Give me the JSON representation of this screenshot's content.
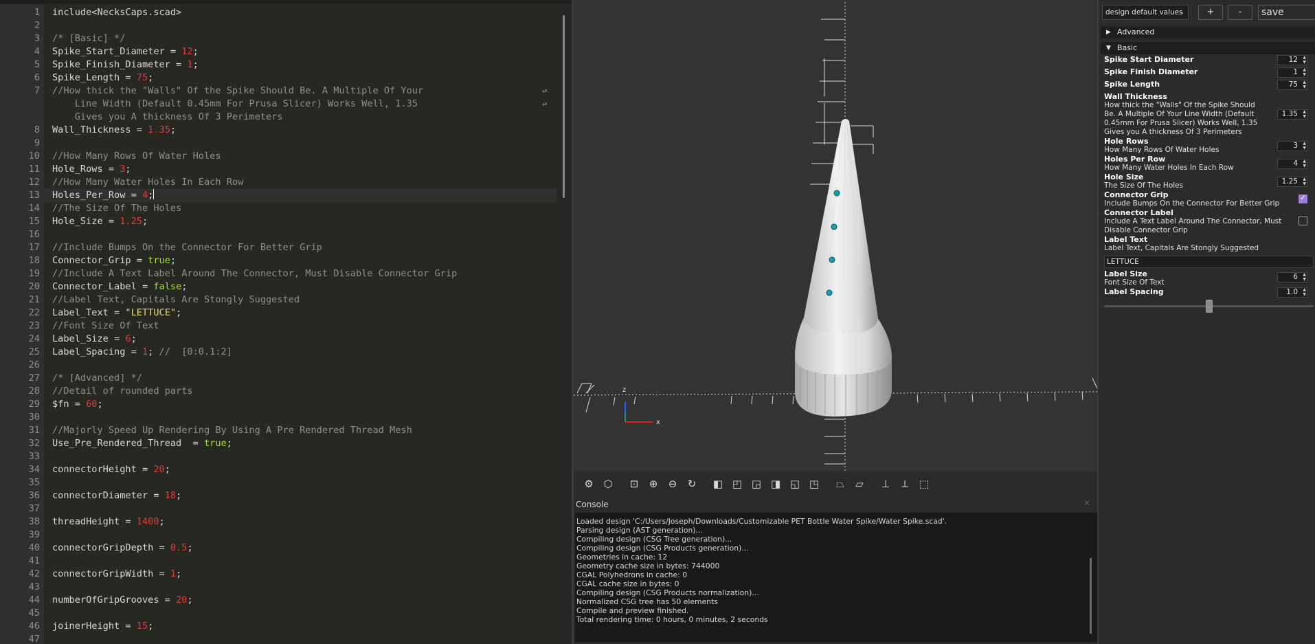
{
  "editor": {
    "lines": [
      {
        "n": "1",
        "parts": [
          {
            "t": "include<NecksCaps.scad>",
            "c": ""
          }
        ]
      },
      {
        "n": "2",
        "parts": []
      },
      {
        "n": "3",
        "parts": [
          {
            "t": "/* [Basic] */",
            "c": "c-comment"
          }
        ]
      },
      {
        "n": "4",
        "parts": [
          {
            "t": "Spike_Start_Diameter = ",
            "c": ""
          },
          {
            "t": "12",
            "c": "c-num"
          },
          {
            "t": ";",
            "c": ""
          }
        ]
      },
      {
        "n": "5",
        "parts": [
          {
            "t": "Spike_Finish_Diameter = ",
            "c": ""
          },
          {
            "t": "1",
            "c": "c-num"
          },
          {
            "t": ";",
            "c": ""
          }
        ]
      },
      {
        "n": "6",
        "parts": [
          {
            "t": "Spike_Length = ",
            "c": ""
          },
          {
            "t": "75",
            "c": "c-num"
          },
          {
            "t": ";",
            "c": ""
          }
        ]
      },
      {
        "n": "7",
        "wrap": true,
        "parts": [
          {
            "t": "//How thick the \"Walls\" Of the Spike Should Be. A Multiple Of Your\n    Line Width (Default 0.45mm For Prusa Slicer) Works Well, 1.35\n    Gives you A thickness Of 3 Perimeters",
            "c": "c-comment"
          }
        ]
      },
      {
        "n": "8",
        "parts": [
          {
            "t": "Wall_Thickness = ",
            "c": ""
          },
          {
            "t": "1.35",
            "c": "c-num"
          },
          {
            "t": ";",
            "c": ""
          }
        ]
      },
      {
        "n": "9",
        "parts": []
      },
      {
        "n": "10",
        "parts": [
          {
            "t": "//How Many Rows Of Water Holes",
            "c": "c-comment"
          }
        ]
      },
      {
        "n": "11",
        "parts": [
          {
            "t": "Hole_Rows = ",
            "c": ""
          },
          {
            "t": "3",
            "c": "c-num"
          },
          {
            "t": ";",
            "c": ""
          }
        ]
      },
      {
        "n": "12",
        "parts": [
          {
            "t": "//How Many Water Holes In Each Row",
            "c": "c-comment"
          }
        ]
      },
      {
        "n": "13",
        "current": true,
        "parts": [
          {
            "t": "Holes_Per_Row = ",
            "c": ""
          },
          {
            "t": "4",
            "c": "c-num"
          },
          {
            "t": ";",
            "c": ""
          }
        ]
      },
      {
        "n": "14",
        "parts": [
          {
            "t": "//The Size Of The Holes",
            "c": "c-comment"
          }
        ]
      },
      {
        "n": "15",
        "parts": [
          {
            "t": "Hole_Size = ",
            "c": ""
          },
          {
            "t": "1.25",
            "c": "c-num"
          },
          {
            "t": ";",
            "c": ""
          }
        ]
      },
      {
        "n": "16",
        "parts": []
      },
      {
        "n": "17",
        "parts": [
          {
            "t": "//Include Bumps On the Connector For Better Grip",
            "c": "c-comment"
          }
        ]
      },
      {
        "n": "18",
        "parts": [
          {
            "t": "Connector_Grip = ",
            "c": ""
          },
          {
            "t": "true",
            "c": "c-kw"
          },
          {
            "t": ";",
            "c": ""
          }
        ]
      },
      {
        "n": "19",
        "parts": [
          {
            "t": "//Include A Text Label Around The Connector, Must Disable Connector Grip",
            "c": "c-comment"
          }
        ]
      },
      {
        "n": "20",
        "parts": [
          {
            "t": "Connector_Label = ",
            "c": ""
          },
          {
            "t": "false",
            "c": "c-kw"
          },
          {
            "t": ";",
            "c": ""
          }
        ]
      },
      {
        "n": "21",
        "parts": [
          {
            "t": "//Label Text, Capitals Are Stongly Suggested",
            "c": "c-comment"
          }
        ]
      },
      {
        "n": "22",
        "parts": [
          {
            "t": "Label_Text = ",
            "c": ""
          },
          {
            "t": "\"LETTUCE\"",
            "c": "c-str"
          },
          {
            "t": ";",
            "c": ""
          }
        ]
      },
      {
        "n": "23",
        "parts": [
          {
            "t": "//Font Size Of Text",
            "c": "c-comment"
          }
        ]
      },
      {
        "n": "24",
        "parts": [
          {
            "t": "Label_Size = ",
            "c": ""
          },
          {
            "t": "6",
            "c": "c-num"
          },
          {
            "t": ";",
            "c": ""
          }
        ]
      },
      {
        "n": "25",
        "parts": [
          {
            "t": "Label_Spacing = ",
            "c": ""
          },
          {
            "t": "1",
            "c": "c-num"
          },
          {
            "t": "; ",
            "c": ""
          },
          {
            "t": "//  [0:0.1:2]",
            "c": "c-comment"
          }
        ]
      },
      {
        "n": "26",
        "parts": []
      },
      {
        "n": "27",
        "parts": [
          {
            "t": "/* [Advanced] */",
            "c": "c-comment"
          }
        ]
      },
      {
        "n": "28",
        "parts": [
          {
            "t": "//Detail of rounded parts",
            "c": "c-comment"
          }
        ]
      },
      {
        "n": "29",
        "parts": [
          {
            "t": "$fn = ",
            "c": ""
          },
          {
            "t": "60",
            "c": "c-num"
          },
          {
            "t": ";",
            "c": ""
          }
        ]
      },
      {
        "n": "30",
        "parts": []
      },
      {
        "n": "31",
        "parts": [
          {
            "t": "//Majorly Speed Up Rendering By Using A Pre Rendered Thread Mesh",
            "c": "c-comment"
          }
        ]
      },
      {
        "n": "32",
        "parts": [
          {
            "t": "Use_Pre_Rendered_Thread  = ",
            "c": ""
          },
          {
            "t": "true",
            "c": "c-kw"
          },
          {
            "t": ";",
            "c": ""
          }
        ]
      },
      {
        "n": "33",
        "parts": []
      },
      {
        "n": "34",
        "parts": [
          {
            "t": "connectorHeight = ",
            "c": ""
          },
          {
            "t": "20",
            "c": "c-num"
          },
          {
            "t": ";",
            "c": ""
          }
        ]
      },
      {
        "n": "35",
        "parts": []
      },
      {
        "n": "36",
        "parts": [
          {
            "t": "connectorDiameter = ",
            "c": ""
          },
          {
            "t": "18",
            "c": "c-num"
          },
          {
            "t": ";",
            "c": ""
          }
        ]
      },
      {
        "n": "37",
        "parts": []
      },
      {
        "n": "38",
        "parts": [
          {
            "t": "threadHeight = ",
            "c": ""
          },
          {
            "t": "1400",
            "c": "c-num"
          },
          {
            "t": ";",
            "c": ""
          }
        ]
      },
      {
        "n": "39",
        "parts": []
      },
      {
        "n": "40",
        "parts": [
          {
            "t": "connectorGripDepth = ",
            "c": ""
          },
          {
            "t": "0.5",
            "c": "c-num"
          },
          {
            "t": ";",
            "c": ""
          }
        ]
      },
      {
        "n": "41",
        "parts": []
      },
      {
        "n": "42",
        "parts": [
          {
            "t": "connectorGripWidth = ",
            "c": ""
          },
          {
            "t": "1",
            "c": "c-num"
          },
          {
            "t": ";",
            "c": ""
          }
        ]
      },
      {
        "n": "43",
        "parts": []
      },
      {
        "n": "44",
        "parts": [
          {
            "t": "numberOfGripGrooves = ",
            "c": ""
          },
          {
            "t": "20",
            "c": "c-num"
          },
          {
            "t": ";",
            "c": ""
          }
        ]
      },
      {
        "n": "45",
        "parts": []
      },
      {
        "n": "46",
        "parts": [
          {
            "t": "joinerHeight = ",
            "c": ""
          },
          {
            "t": "15",
            "c": "c-num"
          },
          {
            "t": ";",
            "c": ""
          }
        ]
      },
      {
        "n": "47",
        "parts": []
      }
    ]
  },
  "viewport": {
    "axis_z_label": "z",
    "axis_x_label": "x",
    "model_color": "#d8d8d8",
    "hole_color": "#1aa0b4"
  },
  "toolbar": {
    "icons": [
      "preview-render-icon",
      "render-icon",
      "view-all-icon",
      "zoom-in-icon",
      "zoom-out-icon",
      "reset-view-icon",
      "view-right-icon",
      "view-top-icon",
      "view-bottom-icon",
      "view-left-icon",
      "view-front-icon",
      "view-back-icon",
      "perspective-icon",
      "orthogonal-icon",
      "show-axes-icon",
      "show-scale-markers-icon",
      "show-edges-icon"
    ]
  },
  "console": {
    "title": "Console",
    "close": "✕",
    "lines": [
      "Loaded design 'C:/Users/Joseph/Downloads/Customizable PET Bottle Water Spike/Water Spike.scad'.",
      "Parsing design (AST generation)...",
      "Compiling design (CSG Tree generation)...",
      "Compiling design (CSG Products generation)...",
      "Geometries in cache: 12",
      "Geometry cache size in bytes: 744000",
      "CGAL Polyhedrons in cache: 0",
      "CGAL cache size in bytes: 0",
      "Compiling design (CSG Products normalization)...",
      "Normalized CSG tree has 50 elements",
      "Compile and preview finished.",
      "Total rendering time: 0 hours, 0 minutes, 2 seconds"
    ]
  },
  "customizer": {
    "preset": "design default values",
    "add_label": "+",
    "remove_label": "-",
    "save_label": "save preset",
    "group_advanced": "Advanced",
    "group_basic": "Basic",
    "params": {
      "spike_start": {
        "name": "Spike Start Diameter",
        "value": "12"
      },
      "spike_finish": {
        "name": "Spike Finish Diameter",
        "value": "1"
      },
      "spike_length": {
        "name": "Spike Length",
        "value": "75"
      },
      "wall": {
        "name": "Wall Thickness",
        "desc": "How thick the \"Walls\" Of the Spike Should Be. A Multiple Of Your Line Width (Default 0.45mm For Prusa Slicer) Works Well, 1.35 Gives you A thickness Of 3 Perimeters",
        "value": "1.35"
      },
      "hole_rows": {
        "name": "Hole Rows",
        "desc": "How Many Rows Of Water Holes",
        "value": "3"
      },
      "holes_per_row": {
        "name": "Holes Per Row",
        "desc": "How Many Water Holes In Each Row",
        "value": "4"
      },
      "hole_size": {
        "name": "Hole Size",
        "desc": "The Size Of The Holes",
        "value": "1.25"
      },
      "connector_grip": {
        "name": "Connector Grip",
        "desc": "Include Bumps On the Connector For Better Grip",
        "checked": true
      },
      "connector_label": {
        "name": "Connector Label",
        "desc": "Include A Text Label Around The Connector, Must Disable Connector Grip",
        "checked": false
      },
      "label_text": {
        "name": "Label Text",
        "desc": "Label Text, Capitals Are Stongly Suggested",
        "value": "LETTUCE"
      },
      "label_size": {
        "name": "Label Size",
        "desc": "Font Size Of Text",
        "value": "6"
      },
      "label_spacing": {
        "name": "Label Spacing",
        "value": "1.0",
        "slider_fraction": 0.5
      }
    }
  }
}
